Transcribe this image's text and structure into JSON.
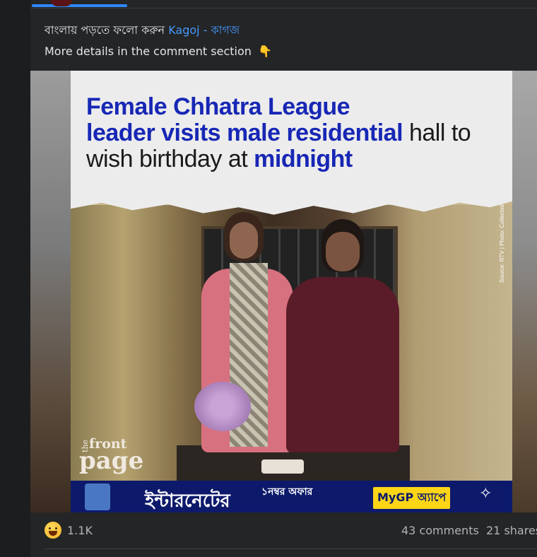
{
  "post": {
    "line1_prefix": "বাংলায় পড়তে ফলো করুন",
    "line1_link": "Kagoj - কাগজ",
    "line2": "More details in the comment section",
    "line2_emoji": "👇"
  },
  "image": {
    "headline_l1_blue": "Female Chhatra League",
    "headline_l2_blue": "leader visits male residential",
    "headline_l2_plain": " hall to",
    "headline_l3_plain": "wish birthday at ",
    "headline_l3_blue": "midnight",
    "side_credit": "Source: RTV | Photo: Collected",
    "brand_the": "the",
    "brand_front": "front",
    "brand_page": "page",
    "ad_text": "ইন্টারনেটের",
    "ad_badge": "১নম্বর অফার",
    "ad_button": "MyGP অ্যাপে",
    "ad_logo": "গ্রামীণফোন"
  },
  "footer": {
    "reaction_count": "1.1K",
    "comments": "43 comments",
    "shares": "21 shares"
  }
}
